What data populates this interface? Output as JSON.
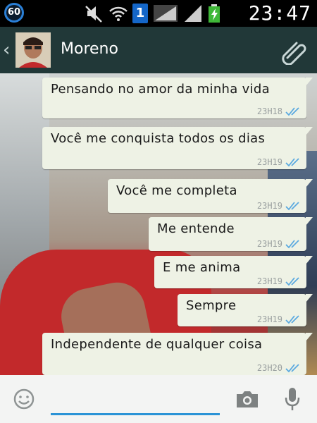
{
  "status_bar": {
    "badge": "60",
    "sim": "1",
    "time": "23:47"
  },
  "header": {
    "back_icon": "‹",
    "contact_name": "Moreno"
  },
  "messages": [
    {
      "text": "Pensando no amor da minha vida",
      "time": "23H18"
    },
    {
      "text": "Você me conquista todos os dias",
      "time": "23H19"
    },
    {
      "text": "Você me completa",
      "time": "23H19"
    },
    {
      "text": "Me entende",
      "time": "23H19"
    },
    {
      "text": "E me anima",
      "time": "23H19"
    },
    {
      "text": "Sempre",
      "time": "23H19"
    },
    {
      "text": "Independente de qualquer coisa",
      "time": "23H20"
    }
  ],
  "input": {
    "placeholder": ""
  },
  "colors": {
    "header_bg": "#213838",
    "bubble_bg": "#eef2e5",
    "tick_blue": "#5aa9e0",
    "accent": "#2b93d6"
  },
  "icons": [
    "mute-icon",
    "wifi-icon",
    "signal-icon",
    "battery-icon",
    "attach-icon",
    "emoji-icon",
    "camera-icon",
    "mic-icon",
    "read-ticks-icon"
  ]
}
